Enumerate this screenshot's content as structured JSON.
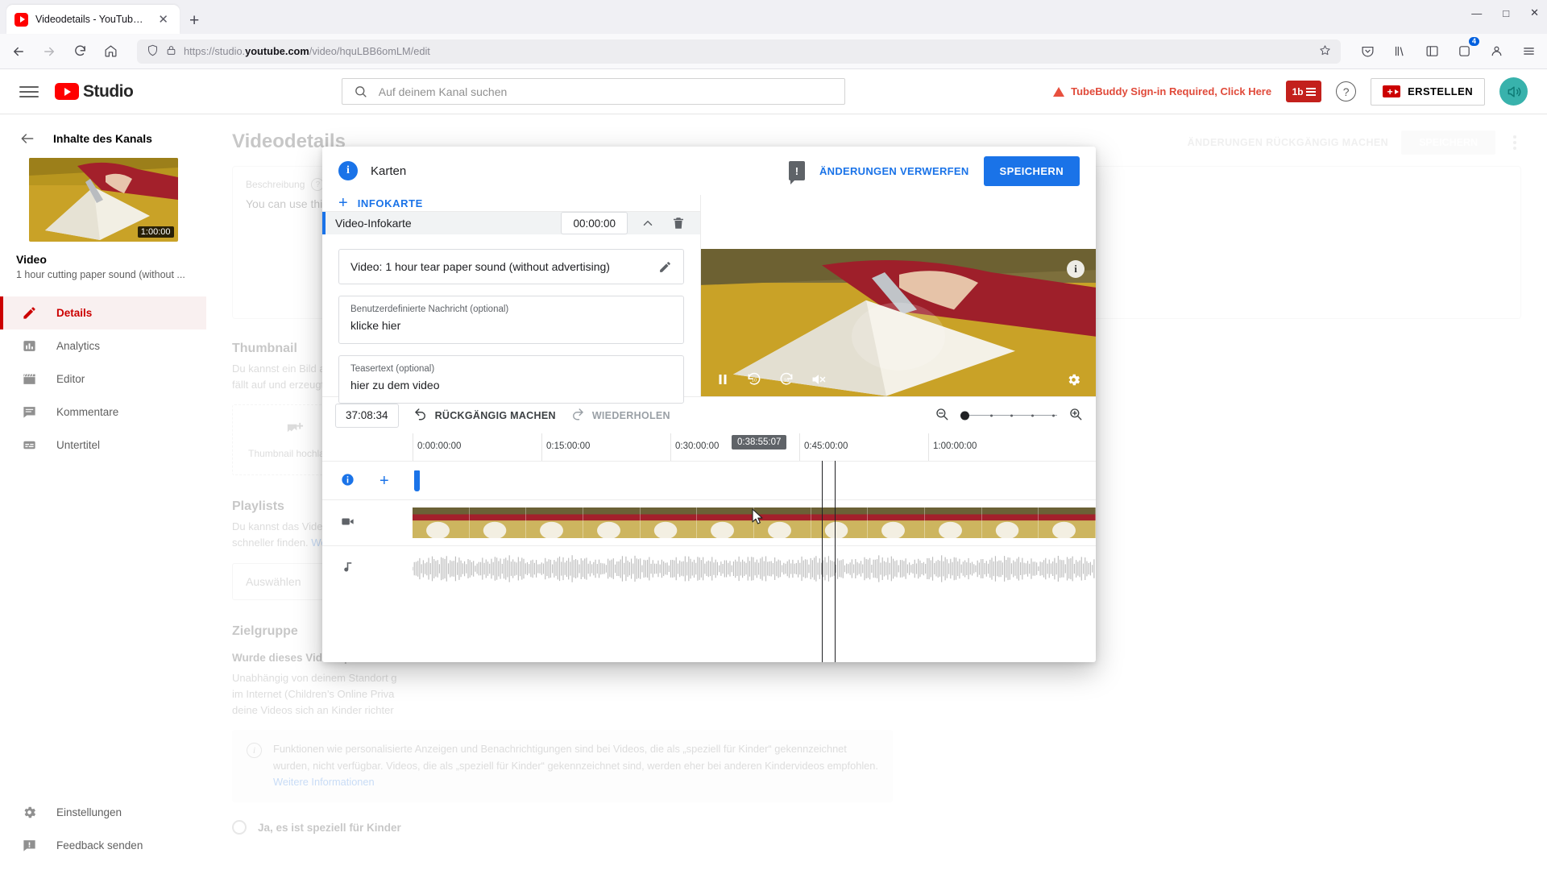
{
  "browser": {
    "tab_title": "Videodetails - YouTube Studio",
    "new_tab_label": "+",
    "close_label": "✕",
    "url_scheme": "https://studio.",
    "url_domain": "youtube.com",
    "url_path": "/video/hquLBB6omLM/edit",
    "extension_badge": "4",
    "window_minimize": "—",
    "window_maximize": "□",
    "window_close": "✕"
  },
  "header": {
    "logo_text": "Studio",
    "search_placeholder": "Auf deinem Kanal suchen",
    "search_value": "",
    "tubebuddy_warning": "TubeBuddy Sign-in Required, Click Here",
    "tubebuddy_badge": "1b",
    "help_glyph": "?",
    "create_label": "ERSTELLEN",
    "avatar_glyph": "🔊"
  },
  "sidebar": {
    "back_label": "Inhalte des Kanals",
    "thumb_duration": "1:00:00",
    "video_label": "Video",
    "video_title": "1 hour cutting paper sound (without ...",
    "items": [
      {
        "label": "Details",
        "icon": "pencil-icon",
        "active": true
      },
      {
        "label": "Analytics",
        "icon": "bar-chart-icon",
        "active": false
      },
      {
        "label": "Editor",
        "icon": "clapperboard-icon",
        "active": false
      },
      {
        "label": "Kommentare",
        "icon": "comment-icon",
        "active": false
      },
      {
        "label": "Untertitel",
        "icon": "subtitles-icon",
        "active": false
      }
    ],
    "bottom_items": [
      {
        "label": "Einstellungen",
        "icon": "gear-icon"
      },
      {
        "label": "Feedback senden",
        "icon": "feedback-icon"
      }
    ]
  },
  "main": {
    "page_title": "Videodetails",
    "undo_label": "ÄNDERUNGEN RÜCKGÄNGIG MACHEN",
    "save_label": "SPEICHERN",
    "description_label": "Beschreibung",
    "description_value": "You can use this sound for f",
    "thumbnail_title": "Thumbnail",
    "thumbnail_desc": "Du kannst ein Bild auswählen oder\nfällt auf und erzeugt Interesse bei d",
    "thumbnail_upload_label": "Thumbnail hochladen",
    "playlists_title": "Playlists",
    "playlists_desc": "Du kannst das Video einer oder me\nschneller finden. ",
    "playlists_link": "Weitere Informati",
    "playlists_select": "Auswählen",
    "audience_title": "Zielgruppe",
    "audience_question": "Wurde dieses Video speziell für Ki",
    "audience_desc": "Unabhängig von deinem Standort g\nim Internet (Children’s Online Priva\ndeine Videos sich an Kinder richter",
    "banner_text": "Funktionen wie personalisierte Anzeigen und Benachrichtigungen sind bei Videos, die als „speziell für Kinder“ gekennzeichnet wurden, nicht verfügbar. Videos, die als „speziell für Kinder“ gekennzeichnet sind, werden eher bei anderen Kindervideos empfohlen. ",
    "banner_link": "Weitere Informationen",
    "radio_yes_label": "Ja, es ist speziell für Kinder"
  },
  "modal": {
    "title": "Karten",
    "info_glyph": "i",
    "warn_glyph": "!",
    "discard_label": "ÄNDERUNGEN VERWERFEN",
    "save_label": "SPEICHERN",
    "add_card_label": "INFOKARTE",
    "add_plus": "+",
    "card": {
      "row_title": "Video-Infokarte",
      "timecode": "00:00:00",
      "collapse_glyph": "⌃",
      "delete_glyph": "🗑",
      "video_field_value": "Video: 1 hour tear paper sound (without advertising)",
      "custom_message_label": "Benutzerdefinierte Nachricht (optional)",
      "custom_message_value": "klicke hier",
      "teaser_label": "Teasertext (optional)",
      "teaser_value": "hier zu dem video"
    }
  },
  "player": {
    "info_glyph": "i",
    "pause_label": "pause",
    "rewind_label": "10",
    "forward_label": "10",
    "mute_label": "muted",
    "settings_label": "settings"
  },
  "timeline": {
    "current_timecode": "37:08:34",
    "undo_label": "RÜCKGÄNGIG MACHEN",
    "redo_label": "WIEDERHOLEN",
    "zoom_out_label": "zoom-out",
    "zoom_in_label": "zoom-in",
    "zoom_value": 0,
    "hover_time": "0:38:55:07",
    "ticks": [
      {
        "label": "0:00:00:00",
        "pos_pct": 0
      },
      {
        "label": "0:15:00:00",
        "pos_pct": 24.2
      },
      {
        "label": "0:30:00:00",
        "pos_pct": 48.4
      },
      {
        "label": "0:45:00:00",
        "pos_pct": 72.6
      },
      {
        "label": "1:00:00:00",
        "pos_pct": 94.5
      }
    ],
    "tracks": [
      {
        "name": "cards",
        "icon": "info-circle-icon",
        "add_glyph": "+"
      },
      {
        "name": "video",
        "icon": "video-camera-icon"
      },
      {
        "name": "audio",
        "icon": "music-note-icon"
      }
    ],
    "playhead_pct": 64.5,
    "marker_pct": 0.4
  },
  "colors": {
    "accent_blue": "#1a73e8",
    "yt_red": "#c00000",
    "warn_red": "#e04a3a",
    "teal_avatar": "#38b2ac"
  }
}
